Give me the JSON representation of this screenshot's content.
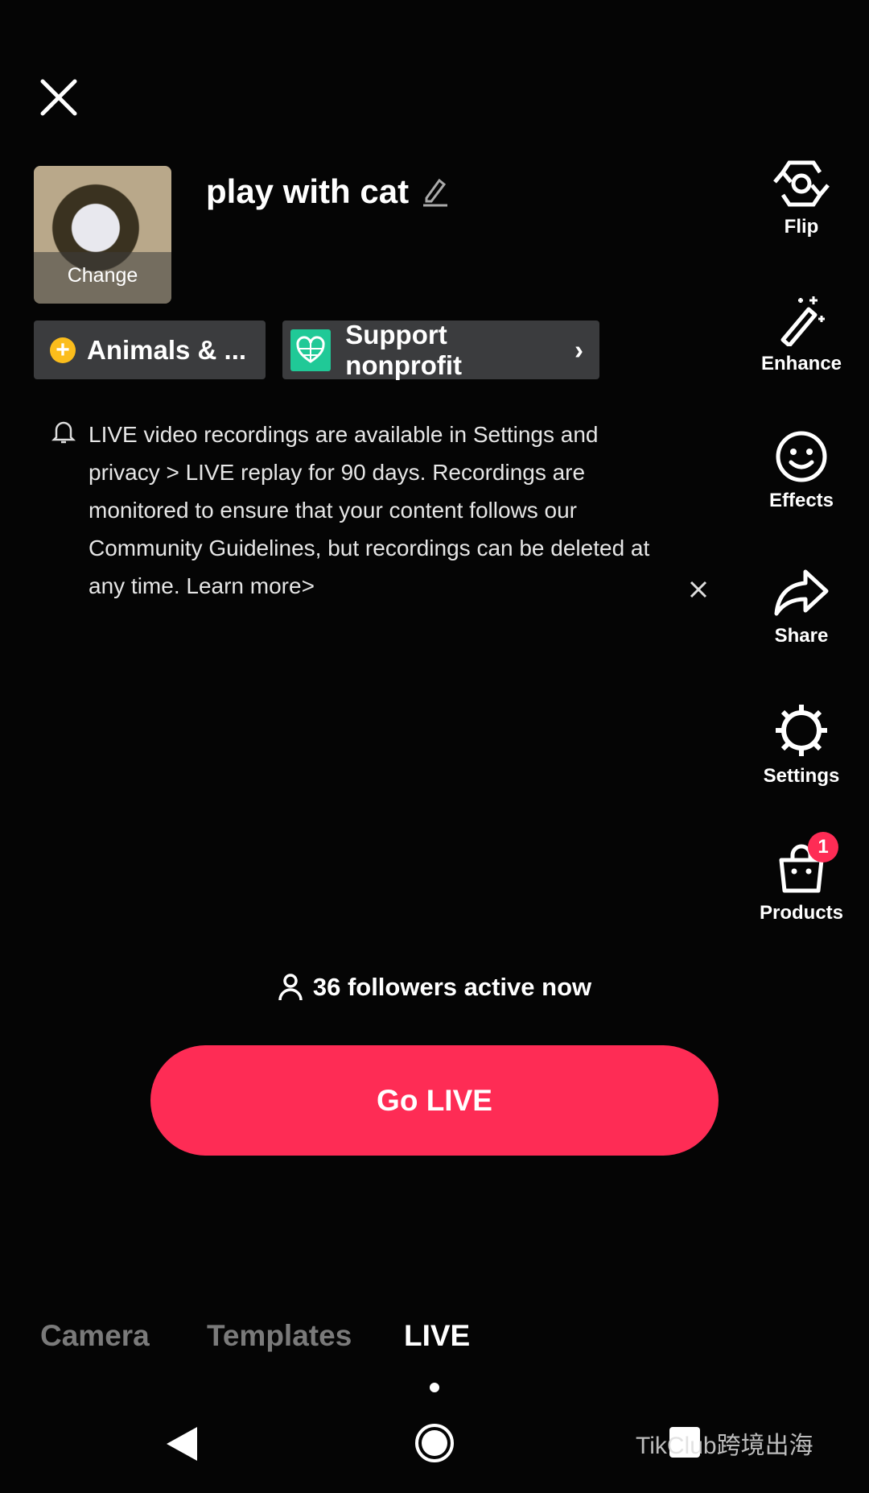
{
  "header": {
    "close_icon": "close-icon"
  },
  "stream": {
    "thumbnail_label": "Change",
    "title": "play with cat"
  },
  "chips": {
    "category": "Animals & ...",
    "nonprofit": "Support nonprofit"
  },
  "notice": {
    "text": "LIVE video recordings are available in Settings and privacy > LIVE replay for 90 days. Recordings are monitored to ensure that your content follows our Community Guidelines, but recordings can be deleted at any time. Learn more>"
  },
  "side_tools": [
    {
      "label": "Flip"
    },
    {
      "label": "Enhance"
    },
    {
      "label": "Effects"
    },
    {
      "label": "Share"
    },
    {
      "label": "Settings"
    },
    {
      "label": "Products",
      "badge": "1"
    }
  ],
  "followers": "36 followers active now",
  "go_live": "Go LIVE",
  "tabs": [
    {
      "label": "Camera"
    },
    {
      "label": "Templates"
    },
    {
      "label": "LIVE",
      "active": true
    }
  ],
  "watermark": "TikClub跨境出海",
  "colors": {
    "accent": "#fe2c55",
    "chip": "#3b3c3e",
    "nonprofit": "#20c997"
  }
}
